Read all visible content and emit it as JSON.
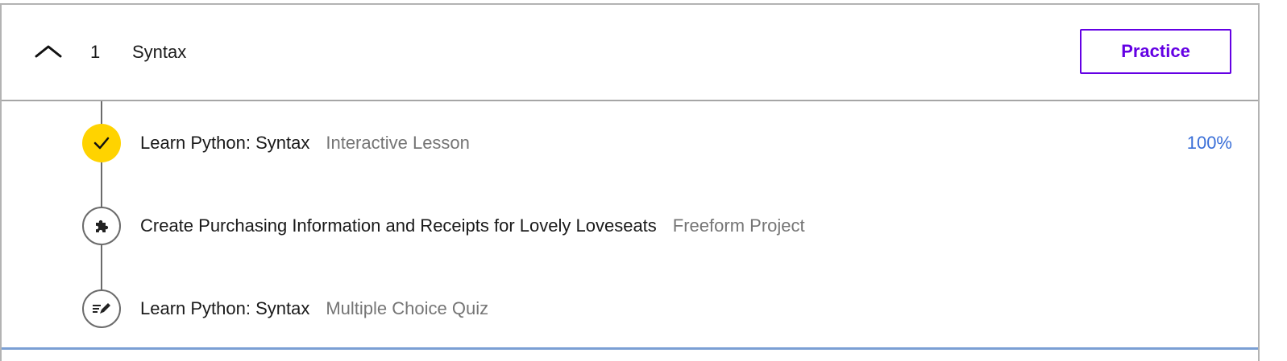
{
  "module": {
    "number": "1",
    "title": "Syntax",
    "practice_label": "Practice",
    "expanded_icon": "chevron-up-icon"
  },
  "items": [
    {
      "title": "Learn Python: Syntax",
      "type": "Interactive Lesson",
      "status": "completed",
      "icon": "checkmark-icon",
      "progress_label": "100%"
    },
    {
      "title": "Create Purchasing Information and Receipts for Lovely Loveseats",
      "type": "Freeform Project",
      "status": "not-started",
      "icon": "puzzle-piece-icon"
    },
    {
      "title": "Learn Python: Syntax",
      "type": "Multiple Choice Quiz",
      "status": "not-started",
      "icon": "quiz-pencil-icon"
    }
  ],
  "colors": {
    "accent": "#6400e4",
    "completed": "#ffd300",
    "progress": "#3a6fd8"
  }
}
